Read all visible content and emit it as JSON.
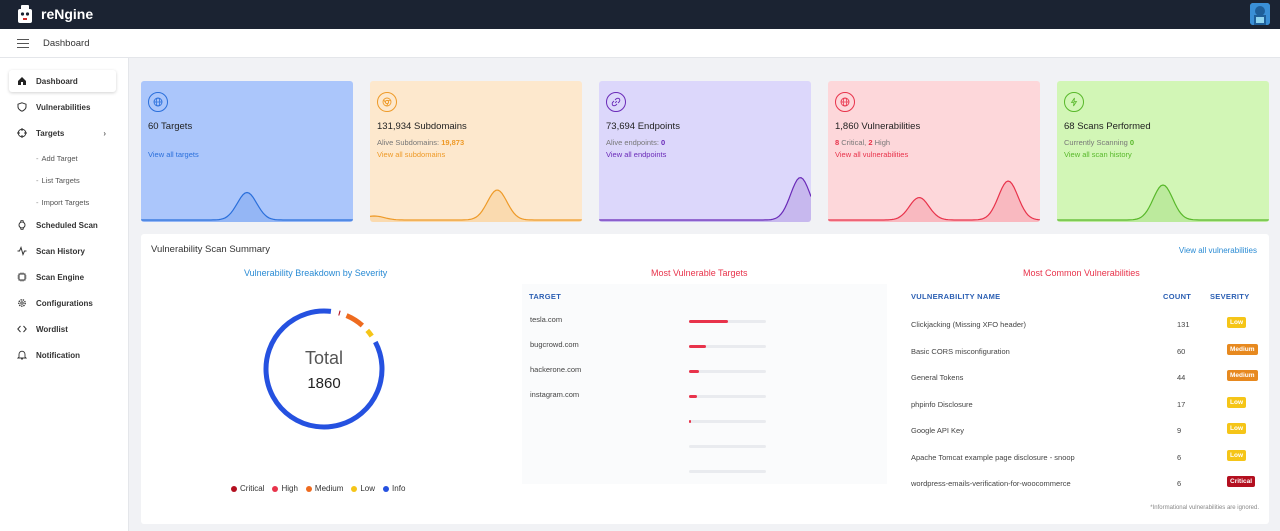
{
  "app": {
    "name": "reNgine"
  },
  "header": {
    "title": "Dashboard"
  },
  "sidebar": {
    "items": [
      {
        "label": "Dashboard"
      },
      {
        "label": "Vulnerabilities"
      },
      {
        "label": "Targets"
      },
      {
        "label": "Scheduled Scan"
      },
      {
        "label": "Scan History"
      },
      {
        "label": "Scan Engine"
      },
      {
        "label": "Configurations"
      },
      {
        "label": "Wordlist"
      },
      {
        "label": "Notification"
      }
    ],
    "targets_sub": [
      "Add Target",
      "List Targets",
      "Import Targets"
    ]
  },
  "cards": [
    {
      "title": "60 Targets",
      "line1_label": "",
      "line1_value": "",
      "link": "View all targets",
      "bg": "#abc6fb",
      "accent": "#2a6fdb"
    },
    {
      "title": "131,934 Subdomains",
      "line1_label": "Alive Subdomains: ",
      "line1_value": "19,873",
      "link": "View all subdomains",
      "bg": "#fde8cd",
      "accent": "#ee9a28"
    },
    {
      "title": "73,694 Endpoints",
      "line1_label": "Alive endpoints: ",
      "line1_value": "0",
      "link": "View all endpoints",
      "bg": "#dcd7fb",
      "accent": "#6a2ab8"
    },
    {
      "title": "1,860 Vulnerabilities",
      "line1_label": "Critical, ",
      "line1_prefix": "8",
      "line1_value": "2",
      "line1_suffix": " High",
      "link": "View all vulnerabilities",
      "bg": "#fdd7da",
      "accent": "#e8334b"
    },
    {
      "title": "68 Scans Performed",
      "line1_label": "Currently Scanning ",
      "line1_value": "0",
      "link": "View all scan history",
      "bg": "#d2f6b6",
      "accent": "#58b82a"
    }
  ],
  "summary": {
    "title": "Vulnerability Scan Summary",
    "view_all": "View all vulnerabilities",
    "breakdown_title": "Vulnerability Breakdown by Severity",
    "targets_title": "Most Vulnerable Targets",
    "common_title": "Most Common Vulnerabilities",
    "total_label": "Total",
    "total_value": "1860",
    "legend": [
      {
        "label": "Critical",
        "color": "#b30f1f"
      },
      {
        "label": "High",
        "color": "#e8334b"
      },
      {
        "label": "Medium",
        "color": "#ee6b1f"
      },
      {
        "label": "Low",
        "color": "#f5c518"
      },
      {
        "label": "Info",
        "color": "#2551e0"
      }
    ],
    "severity_counts": {
      "Critical": 6,
      "High": 0,
      "Medium": 104,
      "Low": 40,
      "Info": 1710
    },
    "targets_header": "TARGET",
    "targets": [
      {
        "name": "tesla.com",
        "fraction": 0.5
      },
      {
        "name": "bugcrowd.com",
        "fraction": 0.22
      },
      {
        "name": "hackerone.com",
        "fraction": 0.13
      },
      {
        "name": "instagram.com",
        "fraction": 0.1
      },
      {
        "name": "",
        "fraction": 0.02
      },
      {
        "name": "",
        "fraction": 0
      },
      {
        "name": "",
        "fraction": 0
      }
    ],
    "vuln_header": {
      "name": "VULNERABILITY NAME",
      "count": "COUNT",
      "severity": "SEVERITY"
    },
    "vulns": [
      {
        "name": "Clickjacking (Missing XFO header)",
        "count": "131",
        "severity": "Low",
        "color": "#f5c518"
      },
      {
        "name": "Basic CORS misconfiguration",
        "count": "60",
        "severity": "Medium",
        "color": "#e7891f"
      },
      {
        "name": "General Tokens",
        "count": "44",
        "severity": "Medium",
        "color": "#e7891f"
      },
      {
        "name": "phpinfo Disclosure",
        "count": "17",
        "severity": "Low",
        "color": "#f5c518"
      },
      {
        "name": "Google API Key",
        "count": "9",
        "severity": "Low",
        "color": "#f5c518"
      },
      {
        "name": "Apache Tomcat example page disclosure - snoop",
        "count": "6",
        "severity": "Low",
        "color": "#f5c518"
      },
      {
        "name": "wordpress-emails-verification-for-woocommerce",
        "count": "6",
        "severity": "Critical",
        "color": "#b30f1f"
      }
    ],
    "footnote": "*Informational vulnerabilities are ignored."
  }
}
